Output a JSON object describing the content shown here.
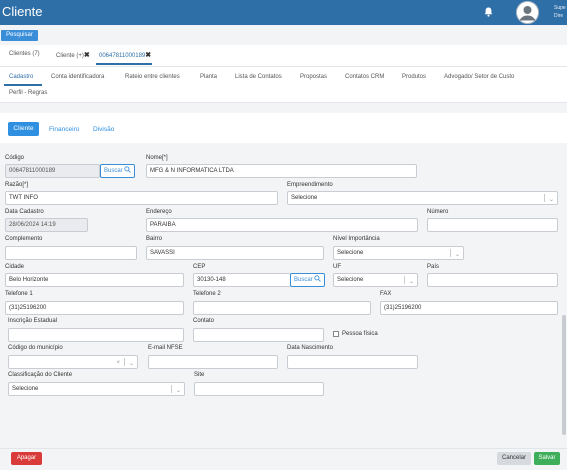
{
  "header": {
    "title": "Cliente",
    "user_line1": "Supe",
    "user_line2": "Dire"
  },
  "toolbar": {
    "search_label": "Pesquisar"
  },
  "doc_tabs": [
    {
      "label": "Clientes (7)"
    },
    {
      "label": "Cliente (+)"
    },
    {
      "label": "00647811000189"
    }
  ],
  "close_glyph": "✖",
  "section_tabs": [
    "Cadastro",
    "Conta identificadora",
    "Rateio entre clientes",
    "Planta",
    "Lista de Contatos",
    "Propostas",
    "Contatos CRM",
    "Produtos",
    "Advogado/ Setor de Custo",
    "Perfil - Regras"
  ],
  "sub_tabs": [
    "Cliente",
    "Financeiro",
    "Divisão"
  ],
  "form": {
    "codigo": {
      "label": "Código",
      "value": "00647811000189",
      "button": "Buscar"
    },
    "nome": {
      "label": "Nome[*]",
      "value": "MFG & N INFORMATICA LTDA"
    },
    "razao": {
      "label": "Razão[*]",
      "value": "TWT INFO"
    },
    "empreendimento": {
      "label": "Empreendimento",
      "value": "Selecione"
    },
    "data_cadastro": {
      "label": "Data Cadastro",
      "value": "28/06/2024 14:19"
    },
    "endereco": {
      "label": "Endereço",
      "value": "PARAIBA"
    },
    "numero": {
      "label": "Número",
      "value": ""
    },
    "complemento": {
      "label": "Complemento",
      "value": ""
    },
    "bairro": {
      "label": "Bairro",
      "value": "SAVASSI"
    },
    "nivel_importancia": {
      "label": "Nível Importância",
      "value": "Selecione"
    },
    "cidade": {
      "label": "Cidade",
      "value": "Belo Horizonte"
    },
    "cep": {
      "label": "CEP",
      "value": "30130-148",
      "button": "Buscar"
    },
    "uf": {
      "label": "UF",
      "value": "Selecione"
    },
    "pais": {
      "label": "País",
      "value": ""
    },
    "telefone1": {
      "label": "Telefone 1",
      "value": "(31)25196200"
    },
    "telefone2": {
      "label": "Telefone 2",
      "value": ""
    },
    "fax": {
      "label": "FAX",
      "value": "(31)25196200"
    },
    "inscricao_estadual": {
      "label": "Inscrição Estadual",
      "value": ""
    },
    "contato": {
      "label": "Contato",
      "value": ""
    },
    "pessoa_fisica": {
      "label": "Pessoa física",
      "checked": false
    },
    "codigo_municipio": {
      "label": "Código do município",
      "value": ""
    },
    "email_nfse": {
      "label": "E-mail NFSE",
      "value": ""
    },
    "data_nascimento": {
      "label": "Data Nascimento",
      "value": ""
    },
    "classificacao": {
      "label": "Classificação do Cliente",
      "value": "Selecione"
    },
    "site": {
      "label": "Site",
      "value": ""
    }
  },
  "footer": {
    "delete_label": "Apagar",
    "cancel_label": "Cancelar",
    "save_label": "Salvar"
  },
  "colors": {
    "header": "#2f6fa8",
    "primary": "#3a8ed8",
    "danger": "#d93a3a",
    "success": "#3fae5a"
  },
  "icons": {
    "bell": "bell-icon",
    "user": "user-avatar-icon",
    "search": "search-icon",
    "chevron": "chevron-down-icon",
    "clear": "clear-icon"
  }
}
